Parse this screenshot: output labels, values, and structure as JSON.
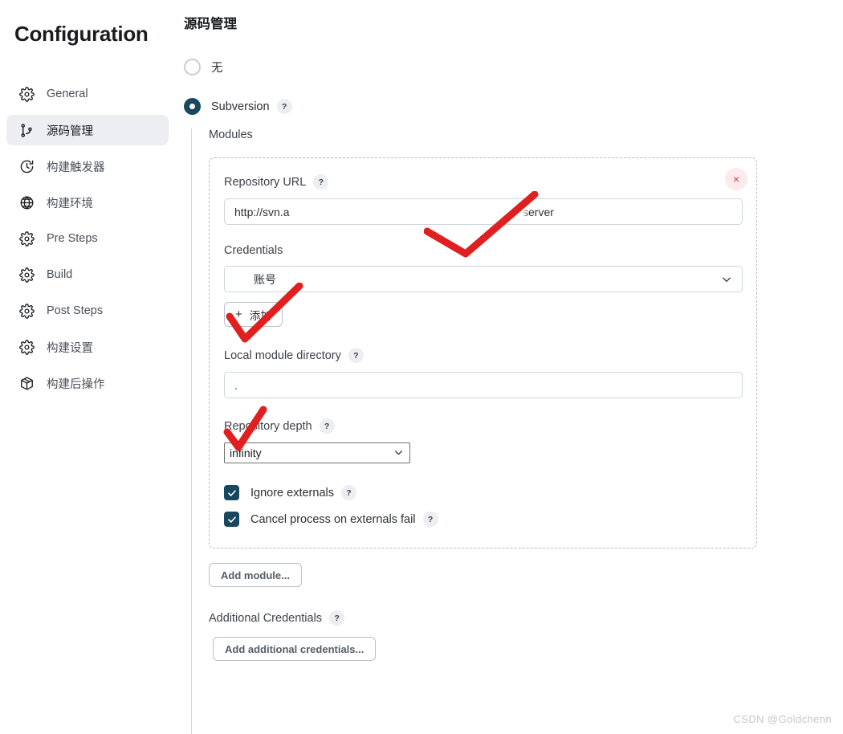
{
  "sidebar": {
    "title": "Configuration",
    "items": [
      {
        "label": "General",
        "icon": "gear-icon",
        "active": false
      },
      {
        "label": "源码管理",
        "icon": "branch-icon",
        "active": true
      },
      {
        "label": "构建触发器",
        "icon": "clock-icon",
        "active": false
      },
      {
        "label": "构建环境",
        "icon": "globe-icon",
        "active": false
      },
      {
        "label": "Pre Steps",
        "icon": "gear-icon",
        "active": false
      },
      {
        "label": "Build",
        "icon": "gear-icon",
        "active": false
      },
      {
        "label": "Post Steps",
        "icon": "gear-icon",
        "active": false
      },
      {
        "label": "构建设置",
        "icon": "gear-icon",
        "active": false
      },
      {
        "label": "构建后操作",
        "icon": "package-icon",
        "active": false
      }
    ]
  },
  "main": {
    "page_title": "源码管理",
    "scm_options": [
      {
        "label": "无",
        "selected": false,
        "help": false
      },
      {
        "label": "Subversion",
        "selected": true,
        "help": true
      }
    ],
    "modules_label": "Modules",
    "module": {
      "repository_url_label": "Repository URL",
      "repository_url_value": "http://svn.a",
      "repository_url_value_tail": "server",
      "credentials_label": "Credentials",
      "credentials_value": "账号",
      "add_credentials_button": "添加",
      "add_credentials_plus": "+",
      "local_module_directory_label": "Local module directory",
      "local_module_directory_value": ".",
      "repository_depth_label": "Repository depth",
      "repository_depth_value": "infinity",
      "checkboxes": [
        {
          "label": "Ignore externals",
          "checked": true,
          "help": true
        },
        {
          "label": "Cancel process on externals fail",
          "checked": true,
          "help": true
        }
      ],
      "close_label": "×"
    },
    "add_module_button": "Add module...",
    "additional_credentials_label": "Additional Credentials",
    "add_additional_credentials_button": "Add additional credentials...",
    "help_glyph": "?"
  },
  "watermark": "CSDN @Goldchenn",
  "colors": {
    "accent": "#17485f",
    "active_nav_bg": "#eceef1",
    "border": "#cfd5db",
    "dashed_border": "#b4bbc4",
    "danger": "#e4393c",
    "danger_bg": "#fdeaec",
    "annotation_red": "#e02020"
  }
}
